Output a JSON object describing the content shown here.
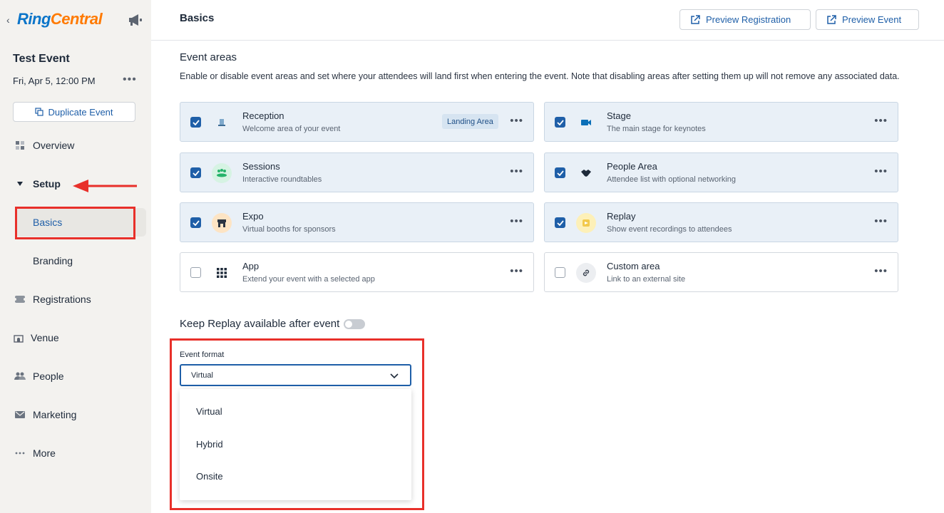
{
  "sidebar": {
    "logo": {
      "part1": "Ring",
      "part2": "Central"
    },
    "event_title": "Test Event",
    "event_date": "Fri, Apr 5, 12:00 PM",
    "more_glyph": "•••",
    "duplicate_label": "Duplicate Event",
    "nav": {
      "overview": "Overview",
      "setup": "Setup",
      "basics": "Basics",
      "branding": "Branding",
      "registrations": "Registrations",
      "venue": "Venue",
      "people": "People",
      "marketing": "Marketing",
      "more": "More"
    }
  },
  "header": {
    "title": "Basics",
    "preview_registration": "Preview Registration",
    "preview_event": "Preview Event"
  },
  "event_areas": {
    "title": "Event areas",
    "description": "Enable or disable event areas and set where your attendees will land first when entering the event. Note that disabling areas after setting them up will not remove any associated data.",
    "landing_badge": "Landing Area",
    "areas": [
      {
        "name": "Reception",
        "desc": "Welcome area of your event",
        "enabled": true,
        "icon": "reception-desk-icon"
      },
      {
        "name": "Stage",
        "desc": "The main stage for keynotes",
        "enabled": true,
        "icon": "video-camera-icon"
      },
      {
        "name": "Sessions",
        "desc": "Interactive roundtables",
        "enabled": true,
        "icon": "roundtable-icon"
      },
      {
        "name": "People Area",
        "desc": "Attendee list with optional networking",
        "enabled": true,
        "icon": "handshake-icon"
      },
      {
        "name": "Expo",
        "desc": "Virtual booths for sponsors",
        "enabled": true,
        "icon": "booth-icon"
      },
      {
        "name": "Replay",
        "desc": "Show event recordings to attendees",
        "enabled": true,
        "icon": "replay-icon"
      },
      {
        "name": "App",
        "desc": "Extend your event with a selected app",
        "enabled": false,
        "icon": "app-grid-icon"
      },
      {
        "name": "Custom area",
        "desc": "Link to an external site",
        "enabled": false,
        "icon": "link-icon"
      }
    ]
  },
  "replay": {
    "label": "Keep Replay available after event",
    "enabled": false
  },
  "event_format": {
    "label": "Event format",
    "selected": "Virtual",
    "options": [
      "Virtual",
      "Hybrid",
      "Onsite"
    ]
  },
  "colors": {
    "accent": "#1f5fa8",
    "brand_blue": "#0b75c9",
    "brand_orange": "#ff7a00",
    "annotation_red": "#e8302a"
  }
}
